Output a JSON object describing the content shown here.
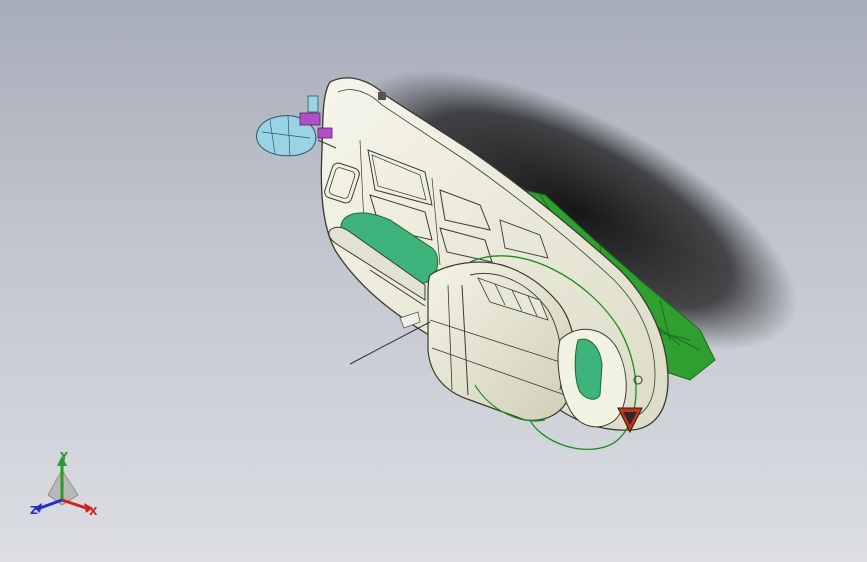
{
  "viewport": {
    "colors": {
      "background_top": "#a7adb9",
      "background_bottom": "#dcdee3",
      "shadow": "#1a1a1a",
      "body_fill": "#eeeede",
      "edge_line": "#3a3a30",
      "green_parts": "#2fa02f",
      "green_dark": "#1b6e1b",
      "teal_panel": "#3eb47c",
      "cyan_part": "#9ad4e4",
      "magenta_part": "#b050c8",
      "red_triangle": "#c8321e"
    },
    "model": {
      "icon": "helicopter-cad-model",
      "parts": [
        "fuselage",
        "tail-boom",
        "cabin",
        "green-frame",
        "nose-dome",
        "side-panel"
      ]
    }
  },
  "triad": {
    "icon": "coordinate-triad-icon",
    "x_label": "X",
    "y_label": "Y",
    "z_label": "Z",
    "colors": {
      "x": "#d02020",
      "y": "#2a9a2a",
      "z": "#2030c8"
    }
  }
}
